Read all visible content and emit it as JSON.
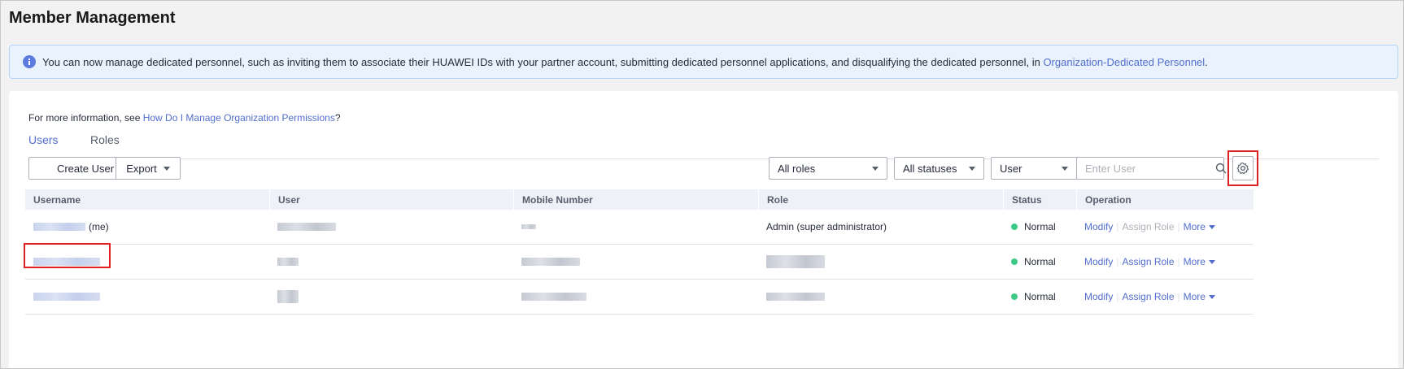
{
  "page": {
    "title": "Member Management"
  },
  "notice": {
    "text": "You can now manage dedicated personnel, such as inviting them to associate their HUAWEI IDs with your partner account, submitting dedicated personnel applications, and disqualifying the dedicated personnel, in ",
    "link": "Organization-Dedicated Personnel",
    "suffix": "."
  },
  "help": {
    "prefix": "For more information, see ",
    "link": "How Do I Manage Organization Permissions",
    "suffix": "?"
  },
  "tabs": [
    {
      "label": "Users"
    },
    {
      "label": "Roles"
    }
  ],
  "toolbar": {
    "create_label": "Create User",
    "export_label": "Export",
    "roles_filter": "All roles",
    "status_filter": "All statuses",
    "search_field": "User",
    "search_placeholder": "Enter User"
  },
  "table": {
    "headers": [
      "Username",
      "User",
      "Mobile Number",
      "Role",
      "Status",
      "Operation"
    ],
    "rows": [
      {
        "me_suffix": "(me)",
        "role": "Admin (super administrator)",
        "status": "Normal",
        "modify": "Modify",
        "assign": "Assign Role",
        "more": "More"
      },
      {
        "status": "Normal",
        "modify": "Modify",
        "assign": "Assign Role",
        "more": "More"
      },
      {
        "status": "Normal",
        "modify": "Modify",
        "assign": "Assign Role",
        "more": "More"
      }
    ]
  },
  "colors": {
    "accent": "#526ecc",
    "status_normal": "#3ec986",
    "highlight": "#e02020"
  },
  "icons": [
    "info-icon",
    "search-icon",
    "gear-icon",
    "caret-down-icon"
  ]
}
